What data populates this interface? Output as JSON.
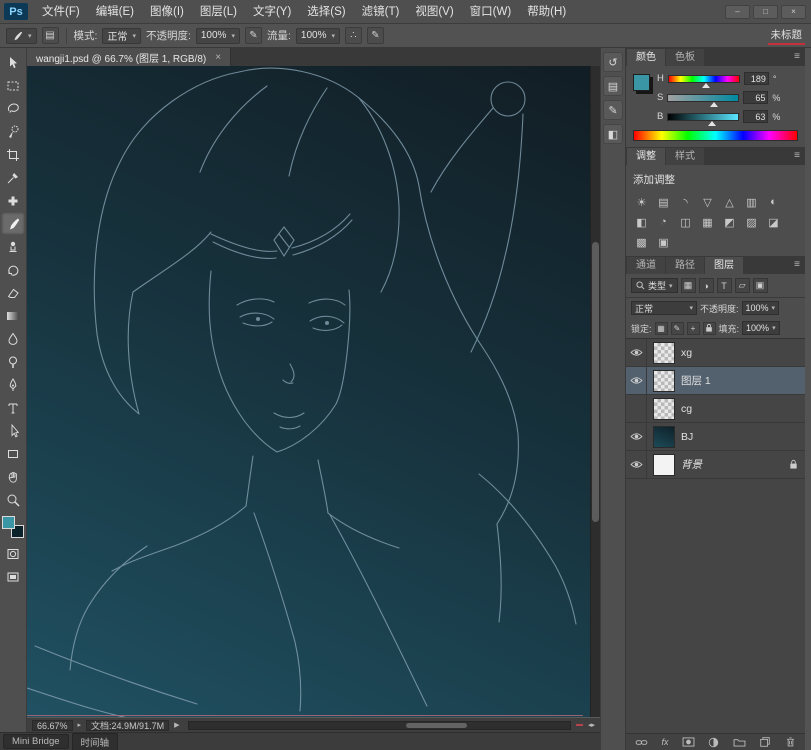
{
  "app": {
    "logo": "Ps",
    "menus": [
      "文件(F)",
      "编辑(E)",
      "图像(I)",
      "图层(L)",
      "文字(Y)",
      "选择(S)",
      "滤镜(T)",
      "视图(V)",
      "窗口(W)",
      "帮助(H)"
    ],
    "workspace": "未标题"
  },
  "options": {
    "mode_label": "模式:",
    "mode": "正常",
    "opacity_label": "不透明度:",
    "opacity": "100%",
    "flow_label": "流量:",
    "flow": "100%"
  },
  "doc": {
    "tab": "wangji1.psd @ 66.7% (图层 1, RGB/8)",
    "close": "×",
    "zoom": "66.67%",
    "info": "文档:24.9M/91.7M"
  },
  "color_panel": {
    "tabs": [
      "颜色",
      "色板"
    ],
    "h": {
      "label": "H",
      "value": "189",
      "unit": "°"
    },
    "s": {
      "label": "S",
      "value": "65",
      "unit": "%"
    },
    "b": {
      "label": "B",
      "value": "63",
      "unit": "%"
    }
  },
  "adjust_panel": {
    "tabs": [
      "调整",
      "样式"
    ],
    "title": "添加调整"
  },
  "layers_panel": {
    "tabs": [
      "通道",
      "路径",
      "图层"
    ],
    "filter_label": "类型",
    "blend_mode": "正常",
    "opacity_label": "不透明度:",
    "opacity": "100%",
    "lock_label": "锁定:",
    "fill_label": "填充:",
    "fill": "100%",
    "fx": "fx",
    "layers": [
      {
        "name": "xg"
      },
      {
        "name": "图层 1"
      },
      {
        "name": "cg"
      },
      {
        "name": "BJ"
      },
      {
        "name": "背景"
      }
    ]
  },
  "bottom": {
    "tabs": [
      "Mini Bridge",
      "时间轴"
    ]
  },
  "colors": {
    "foreground_swatch": "#3a96a5",
    "background_swatch": "#0b222b",
    "canvas_top": "#121d24",
    "canvas_bottom": "#205162",
    "selected_layer": "#53616e",
    "sketch_line": "#86a2b2"
  }
}
